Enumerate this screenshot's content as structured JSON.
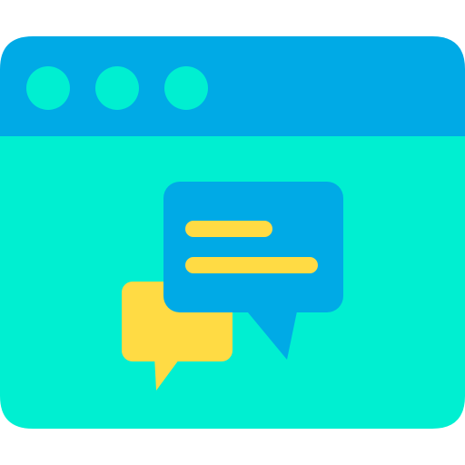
{
  "icon": {
    "name": "browser-chat-icon",
    "colors": {
      "titlebar": "#00AAE6",
      "window_body": "#00EFD1",
      "window_dots": "#00EFD1",
      "chat_bubble_front": "#00AAE6",
      "chat_bubble_back": "#FFDB44",
      "chat_lines": "#FFDB44"
    }
  }
}
